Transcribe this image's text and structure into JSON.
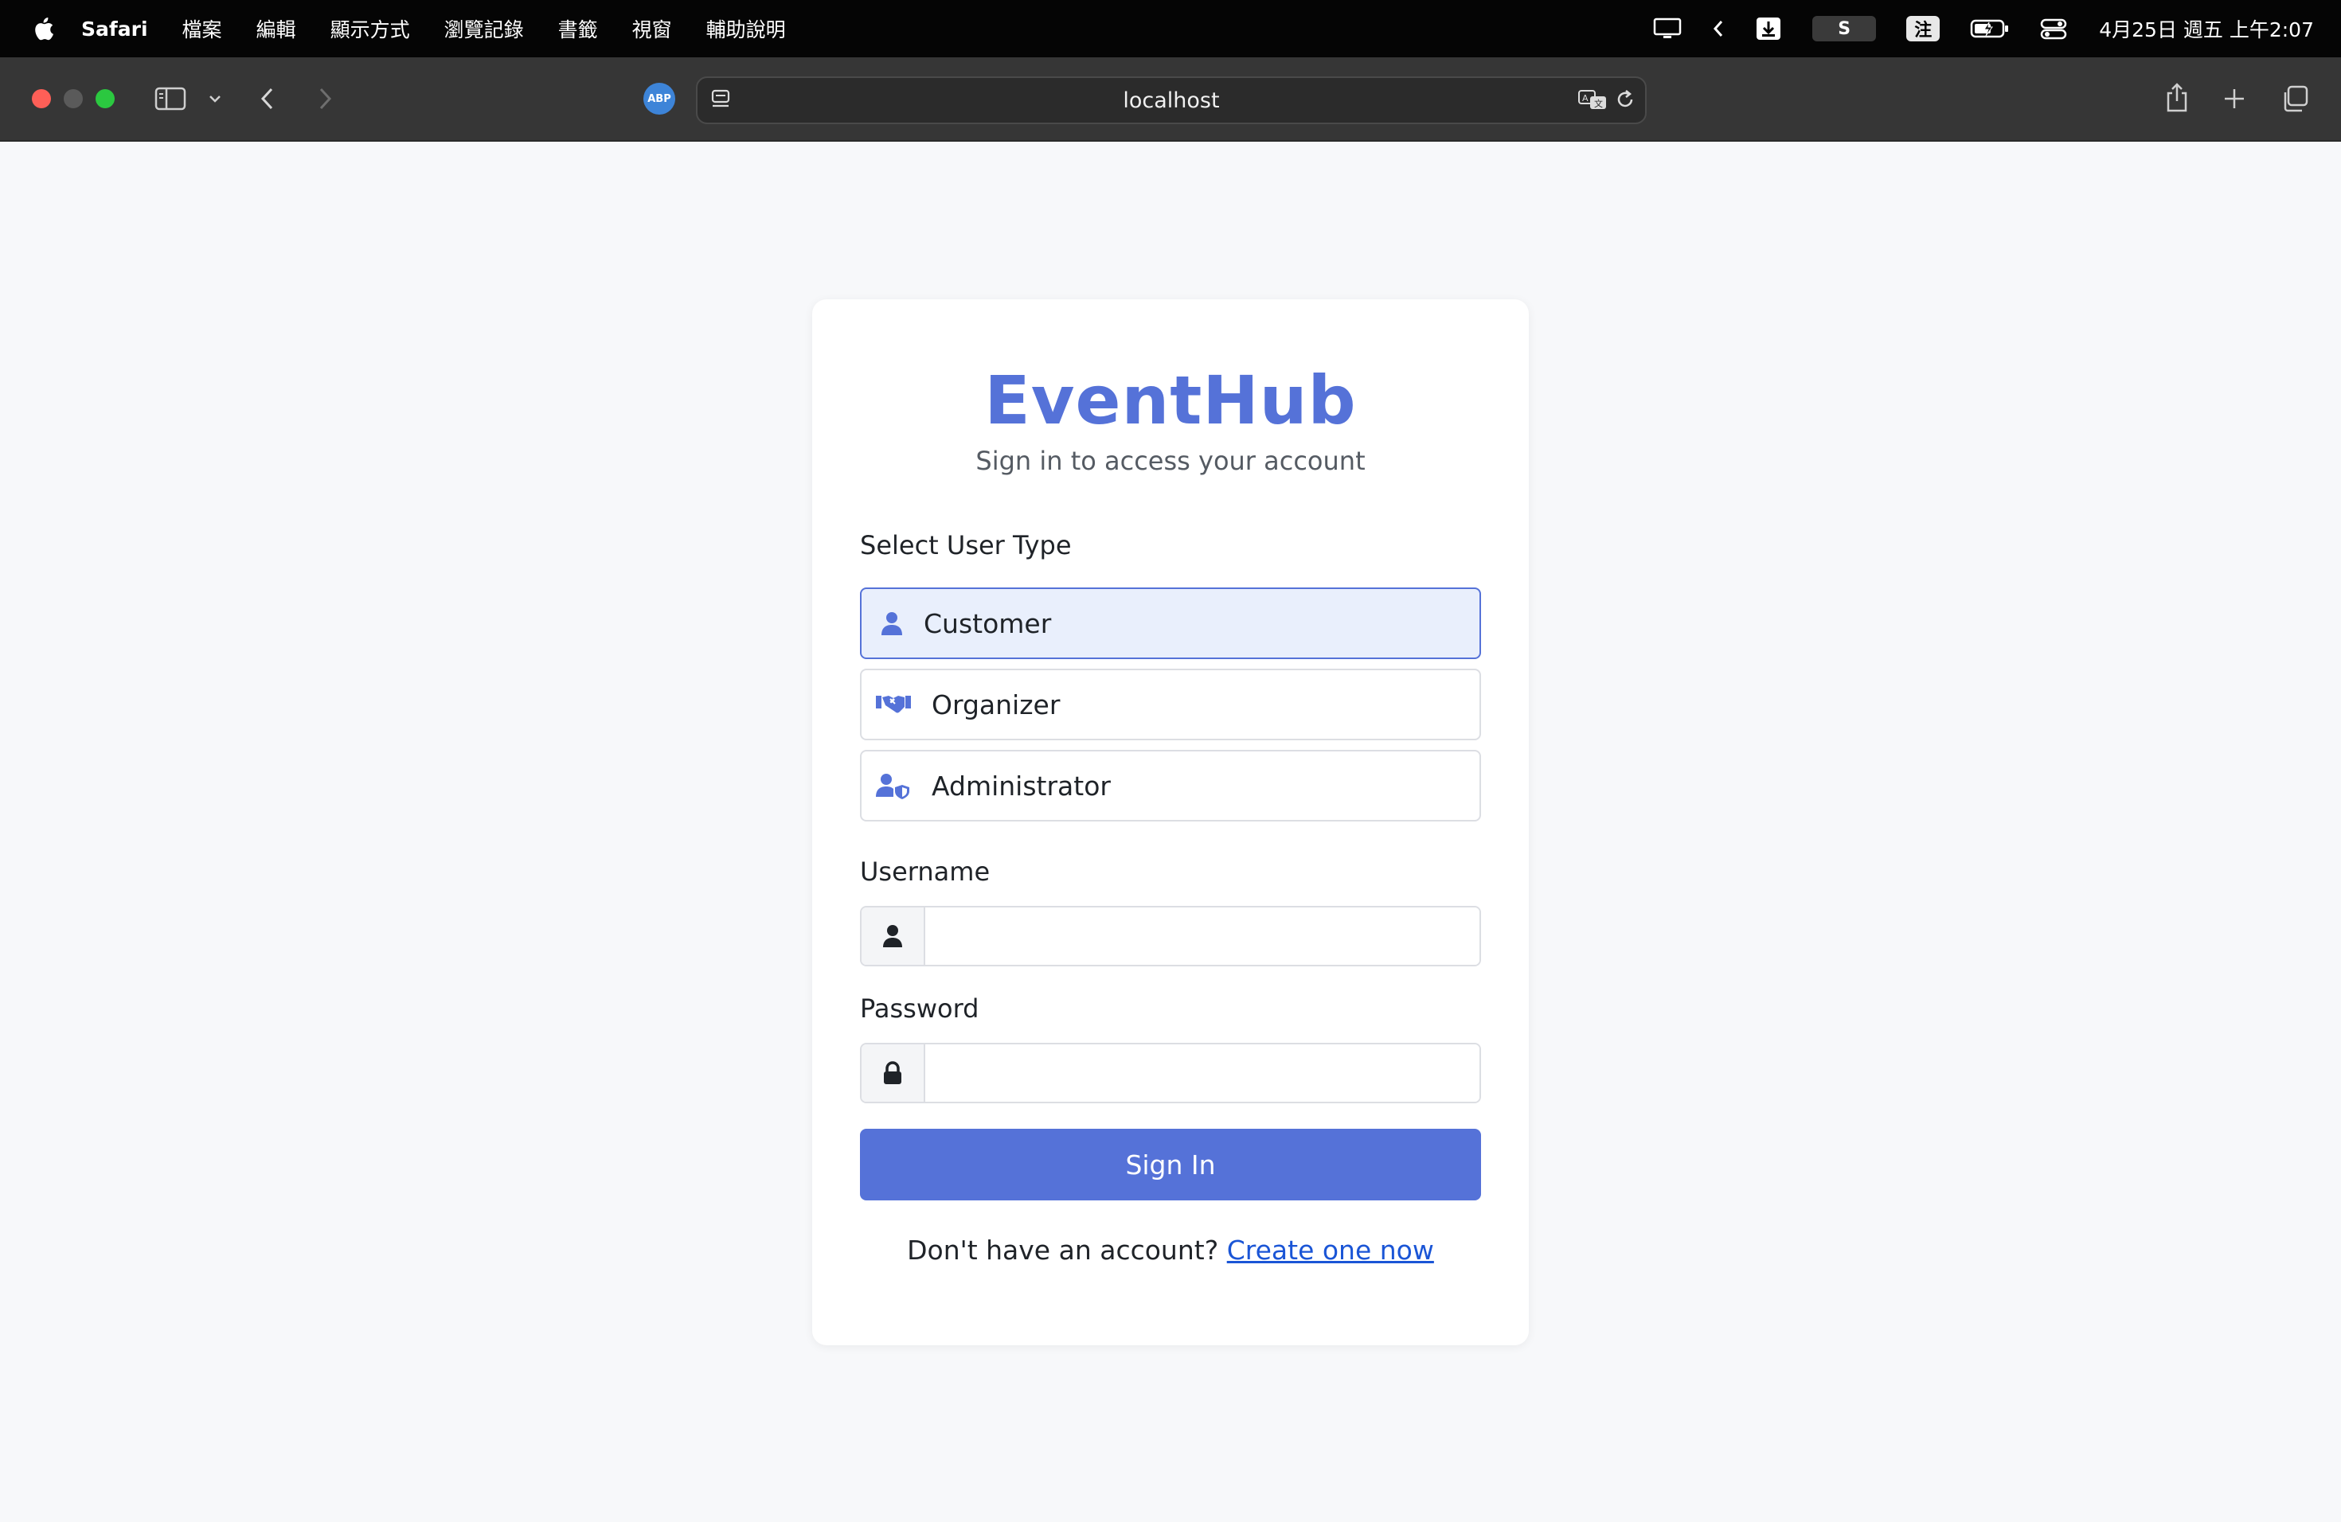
{
  "menubar": {
    "app_name": "Safari",
    "items": [
      "檔案",
      "編輯",
      "顯示方式",
      "瀏覽記錄",
      "書籤",
      "視窗",
      "輔助說明"
    ],
    "tray": {
      "s_label": "S",
      "input_label": "注"
    },
    "clock": "4月25日 週五 上午2:07"
  },
  "browser": {
    "url": "localhost",
    "abp_label": "ABP"
  },
  "login": {
    "brand": "EventHub",
    "subtitle": "Sign in to access your account",
    "user_type_label": "Select User Type",
    "user_types": [
      {
        "label": "Customer",
        "icon": "user-icon",
        "selected": true
      },
      {
        "label": "Organizer",
        "icon": "handshake-icon",
        "selected": false
      },
      {
        "label": "Administrator",
        "icon": "user-shield-icon",
        "selected": false
      }
    ],
    "username_label": "Username",
    "username_value": "",
    "password_label": "Password",
    "password_value": "",
    "submit_label": "Sign In",
    "footer_text": "Don't have an account?",
    "footer_link": "Create one now"
  },
  "colors": {
    "accent": "#5572d8",
    "selected_bg": "#e9effc",
    "link": "#1a55d6",
    "page_bg": "#f7f8fa"
  }
}
